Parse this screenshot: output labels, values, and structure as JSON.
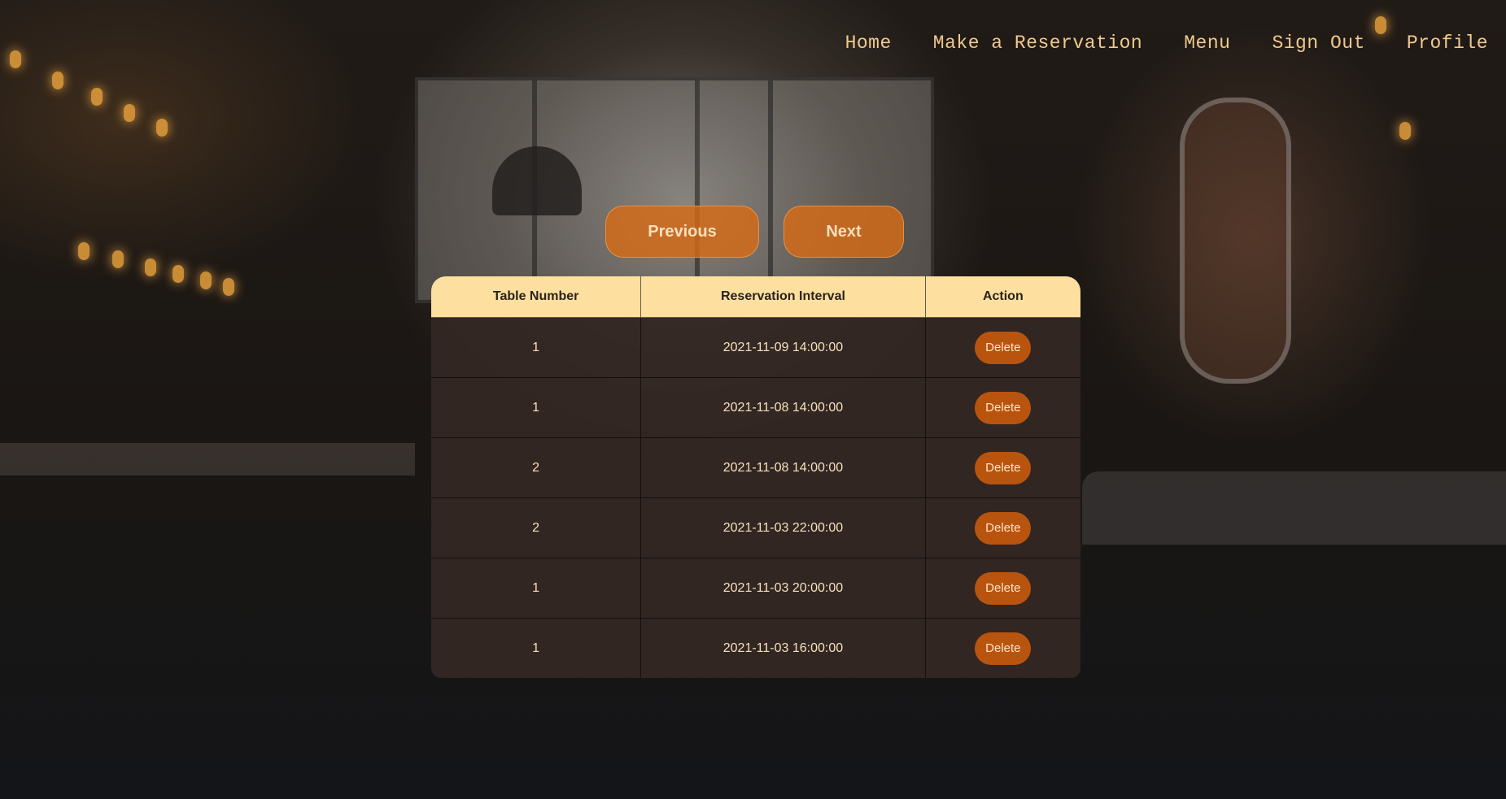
{
  "nav": {
    "items": [
      {
        "label": "Home"
      },
      {
        "label": "Make a Reservation"
      },
      {
        "label": "Menu"
      },
      {
        "label": "Sign Out"
      },
      {
        "label": "Profile"
      }
    ]
  },
  "pager": {
    "previous_label": "Previous",
    "next_label": "Next"
  },
  "reservations": {
    "columns": [
      "Table Number",
      "Reservation Interval",
      "Action"
    ],
    "rows": [
      {
        "table_number": "1",
        "interval": "2021-11-09 14:00:00",
        "action": "Delete"
      },
      {
        "table_number": "1",
        "interval": "2021-11-08 14:00:00",
        "action": "Delete"
      },
      {
        "table_number": "2",
        "interval": "2021-11-08 14:00:00",
        "action": "Delete"
      },
      {
        "table_number": "2",
        "interval": "2021-11-03 22:00:00",
        "action": "Delete"
      },
      {
        "table_number": "1",
        "interval": "2021-11-03 20:00:00",
        "action": "Delete"
      },
      {
        "table_number": "1",
        "interval": "2021-11-03 16:00:00",
        "action": "Delete"
      }
    ]
  },
  "colors": {
    "accent": "#d66a16",
    "header_bg": "#fde0a0",
    "nav_text": "#f0c98c",
    "delete_bg": "#b9540f"
  },
  "background": {
    "icon": "restaurant-interior-photo"
  }
}
